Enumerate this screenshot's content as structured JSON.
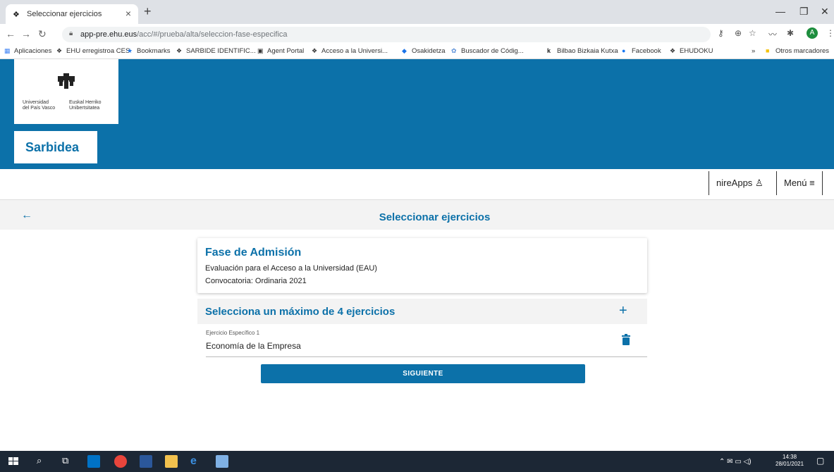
{
  "browser": {
    "tab_title": "Seleccionar ejercicios",
    "url_host": "app-pre.ehu.eus",
    "url_path": "/acc/#/prueba/alta/seleccion-fase-especifica",
    "avatar_letter": "A",
    "bookmarks": [
      "Aplicaciones",
      "EHU erregistroa CES",
      "Bookmarks",
      "SARBIDE IDENTIFIC...",
      "Agent Portal",
      "Acceso a la Universi...",
      "Osakidetza",
      "Buscador de Códig...",
      "Bilbao Bizkaia Kutxa",
      "Facebook",
      "EHUDOKU"
    ],
    "other_bookmarks": "Otros marcadores",
    "more": "»"
  },
  "header": {
    "logo_left": [
      "Universidad",
      "del País Vasco"
    ],
    "logo_right": [
      "Euskal Herriko",
      "Unibertsitatea"
    ],
    "brand": "Sarbidea",
    "nireapps": "nireApps",
    "menu": "Menú"
  },
  "page": {
    "back": "←",
    "title": "Seleccionar ejercicios"
  },
  "card": {
    "heading": "Fase de Admisión",
    "line1": "Evaluación para el Acceso a la Universidad (EAU)",
    "line2": "Convocatoria: Ordinaria 2021"
  },
  "selection": {
    "heading": "Selecciona un máximo de 4 ejercicios",
    "add": "+",
    "items": [
      {
        "label": "Ejercicio Específico 1",
        "value": "Economía de la Empresa"
      }
    ]
  },
  "next_button": "SIGUIENTE",
  "taskbar": {
    "time": "14:38",
    "date": "28/01/2021"
  },
  "colors": {
    "primary": "#0c71a9",
    "taskbar": "#1c2735"
  }
}
